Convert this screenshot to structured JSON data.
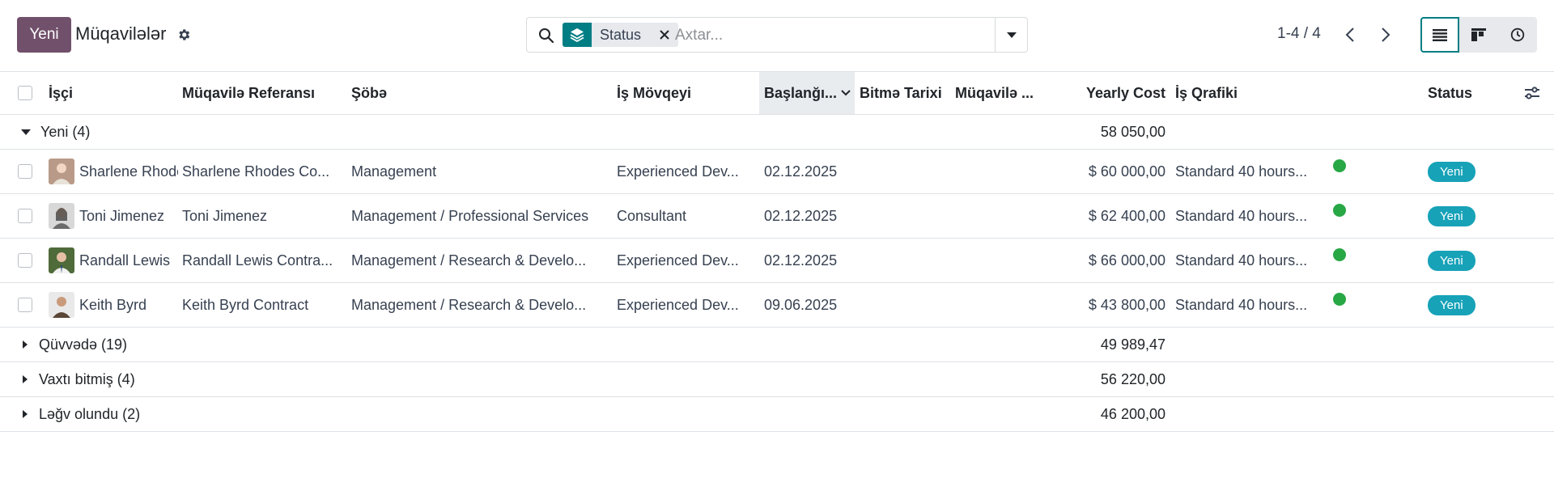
{
  "control_panel": {
    "new_button": "Yeni",
    "breadcrumb_title": "Müqavilələr",
    "search": {
      "facet_value": "Status",
      "placeholder": "Axtar..."
    },
    "pager": "1-4 / 4"
  },
  "columns": {
    "employee": "İşçi",
    "reference": "Müqavilə Referansı",
    "department": "Şöbə",
    "job": "İş Mövqeyi",
    "start_date": "Başlanğı...",
    "end_date": "Bitmə Tarixi",
    "contract_type": "Müqavilə ...",
    "yearly_cost": "Yearly Cost",
    "schedule": "İş Qrafiki",
    "status": "Status"
  },
  "groups": [
    {
      "label": "Yeni (4)",
      "total": "58 050,00",
      "expanded": true
    },
    {
      "label": "Qüvvədə (19)",
      "total": "49 989,47",
      "expanded": false
    },
    {
      "label": "Vaxtı bitmiş (4)",
      "total": "56 220,00",
      "expanded": false
    },
    {
      "label": "Ləğv olundu (2)",
      "total": "46 200,00",
      "expanded": false
    }
  ],
  "records": [
    {
      "employee": "Sharlene Rhodes",
      "reference": "Sharlene Rhodes Co...",
      "department": "Management",
      "job": "Experienced Dev...",
      "start_date": "02.12.2025",
      "yearly_cost": "$ 60 000,00",
      "schedule": "Standard 40 hours...",
      "status": "Yeni",
      "avatar_color": "#b99a88"
    },
    {
      "employee": "Toni Jimenez",
      "reference": "Toni Jimenez",
      "department": "Management / Professional Services",
      "job": "Consultant",
      "start_date": "02.12.2025",
      "yearly_cost": "$ 62 400,00",
      "schedule": "Standard 40 hours...",
      "status": "Yeni",
      "avatar_color": "#6b6b6b"
    },
    {
      "employee": "Randall Lewis",
      "reference": "Randall Lewis Contra...",
      "department": "Management / Research & Develo...",
      "job": "Experienced Dev...",
      "start_date": "02.12.2025",
      "yearly_cost": "$ 66 000,00",
      "schedule": "Standard 40 hours...",
      "status": "Yeni",
      "avatar_color": "#4f6b3a"
    },
    {
      "employee": "Keith Byrd",
      "reference": "Keith Byrd Contract",
      "department": "Management / Research & Develo...",
      "job": "Experienced Dev...",
      "start_date": "09.06.2025",
      "yearly_cost": "$ 43 800,00",
      "schedule": "Standard 40 hours...",
      "status": "Yeni",
      "avatar_color": "#5a4636"
    }
  ],
  "colors": {
    "brand": "#71506b",
    "accent": "#017e84",
    "status_green": "#28a745",
    "badge": "#17a2b8"
  }
}
